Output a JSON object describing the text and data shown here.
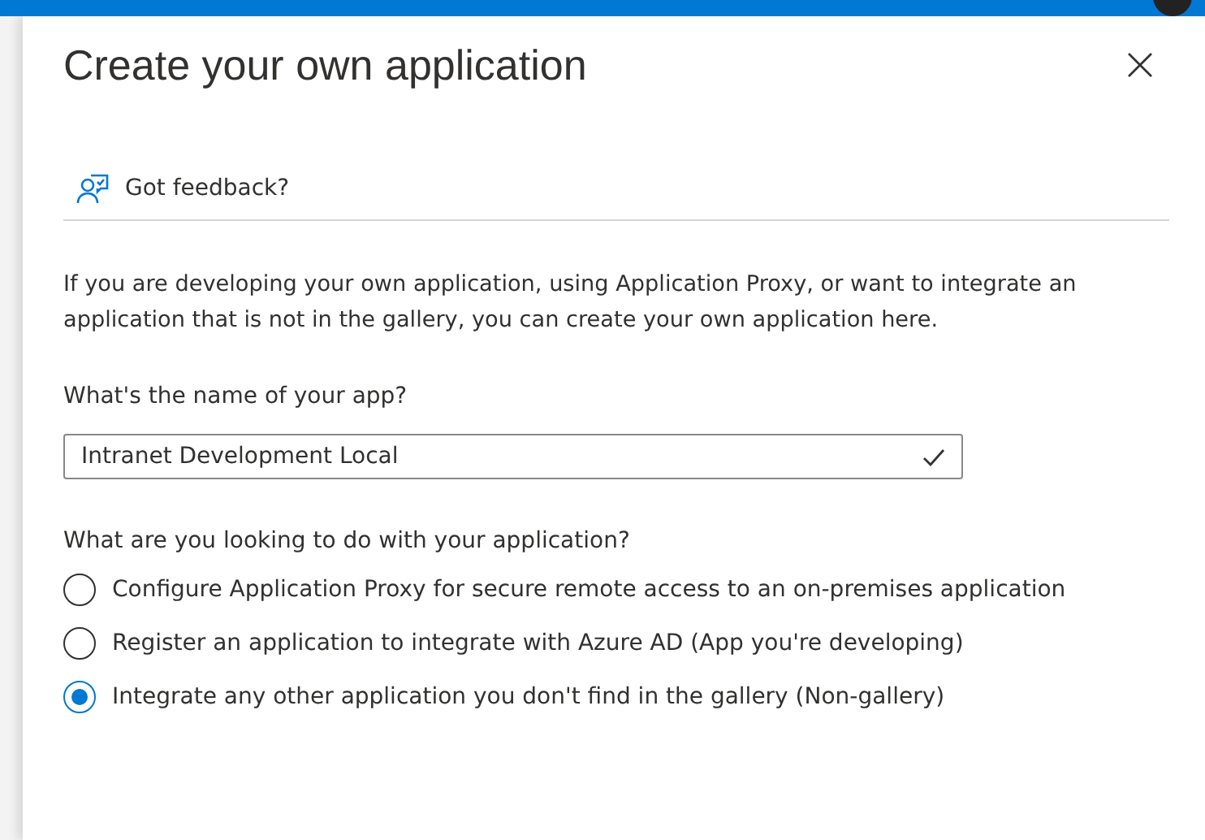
{
  "panel": {
    "title": "Create your own application",
    "feedback": "Got feedback?",
    "description": "If you are developing your own application, using Application Proxy, or want to integrate an application that is not in the gallery, you can create your own application here.",
    "name_field": {
      "label": "What's the name of your app?",
      "value": "Intranet Development Local",
      "valid": true
    },
    "purpose": {
      "label": "What are you looking to do with your application?",
      "options": [
        {
          "label": "Configure Application Proxy for secure remote access to an on-premises application",
          "selected": false
        },
        {
          "label": "Register an application to integrate with Azure AD (App you're developing)",
          "selected": false
        },
        {
          "label": "Integrate any other application you don't find in the gallery (Non-gallery)",
          "selected": true
        }
      ]
    }
  }
}
